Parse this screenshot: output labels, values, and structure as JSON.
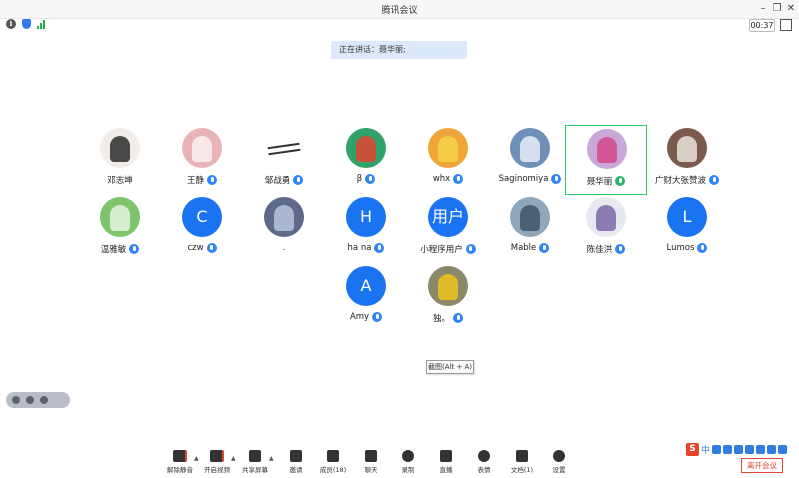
{
  "window": {
    "title": "腾讯会议",
    "timer": "00:37"
  },
  "speaking_banner": "正在讲话：聂华丽;",
  "participants": [
    {
      "name": "邓志坤",
      "avatar": "photo",
      "mic": false,
      "bg": "#f2ede8",
      "fg": "#2a2a2a"
    },
    {
      "name": "王静",
      "avatar": "photo",
      "mic": true,
      "bg": "#e8b4b8",
      "fg": "#f7f1ef"
    },
    {
      "name": "邹战勇",
      "avatar": "signature",
      "mic": true,
      "bg": "#ffffff",
      "fg": "#333333"
    },
    {
      "name": "β",
      "avatar": "photo",
      "mic": true,
      "bg": "#2fa36a",
      "fg": "#e04430"
    },
    {
      "name": "whx",
      "avatar": "photo",
      "mic": true,
      "bg": "#f2a53a",
      "fg": "#f7d44a"
    },
    {
      "name": "Saginomiya",
      "avatar": "photo",
      "mic": true,
      "bg": "#6d8fb8",
      "fg": "#e9eef5"
    },
    {
      "name": "聂华丽",
      "avatar": "photo",
      "mic": true,
      "bg": "#c9a7d8",
      "fg": "#d24a88",
      "active": true
    },
    {
      "name": "广财大张赞波",
      "avatar": "photo",
      "mic": true,
      "bg": "#7a5a4a",
      "fg": "#e9e4da"
    },
    {
      "name": "温雅敏",
      "avatar": "photo",
      "mic": true,
      "bg": "#7ec46a",
      "fg": "#e8f4e0"
    },
    {
      "name": "czw",
      "avatar": "letter",
      "letter": "C",
      "mic": true
    },
    {
      "name": ".",
      "avatar": "photo",
      "mic": false,
      "bg": "#5f6a8a",
      "fg": "#b9c3dc"
    },
    {
      "name": "ha na",
      "avatar": "letter",
      "letter": "H",
      "mic": true
    },
    {
      "name": "小程序用户",
      "avatar": "letter",
      "letter": "用户",
      "mic": true
    },
    {
      "name": "Mable",
      "avatar": "photo",
      "mic": true,
      "bg": "#8fa7b8",
      "fg": "#3f5566"
    },
    {
      "name": "陈佳洪",
      "avatar": "photo",
      "mic": true,
      "bg": "#e8e8f0",
      "fg": "#7a6aa8"
    },
    {
      "name": "Lumos",
      "avatar": "letter",
      "letter": "L",
      "mic": true
    },
    {
      "name": "Amy",
      "avatar": "letter",
      "letter": "A",
      "mic": true
    },
    {
      "name": "独。",
      "avatar": "photo",
      "mic": true,
      "bg": "#8a8a6a",
      "fg": "#f2c21e"
    }
  ],
  "tooltip": "截图(Alt + A)",
  "toolbar": [
    {
      "label": "解除静音",
      "icon": "mic-muted-icon"
    },
    {
      "label": "开启视频",
      "icon": "video-off-icon"
    },
    {
      "label": "共享屏幕",
      "icon": "share-screen-icon"
    },
    {
      "label": "邀请",
      "icon": "invite-icon"
    },
    {
      "label": "成员(18)",
      "icon": "members-icon"
    },
    {
      "label": "聊天",
      "icon": "chat-icon"
    },
    {
      "label": "录制",
      "icon": "record-icon"
    },
    {
      "label": "直播",
      "icon": "live-icon"
    },
    {
      "label": "表情",
      "icon": "emoji-icon"
    },
    {
      "label": "文档(1)",
      "icon": "document-icon"
    },
    {
      "label": "设置",
      "icon": "settings-icon"
    }
  ],
  "ime": {
    "logo": "S",
    "mode": "中"
  },
  "leave_label": "离开会议",
  "colors": {
    "accent": "#1a73f0",
    "active_border": "#35c36b",
    "leave": "#e0463a"
  }
}
